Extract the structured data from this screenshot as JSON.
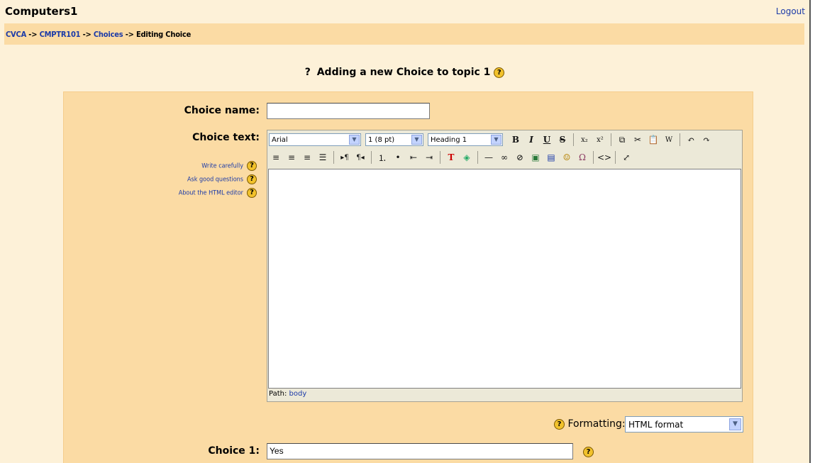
{
  "site": {
    "title": "Computers1",
    "logout": "Logout"
  },
  "breadcrumb": {
    "home": "CVCA",
    "course": "CMPTR101",
    "module": "Choices",
    "current": "Editing Choice",
    "separator": "->"
  },
  "heading": {
    "prefix": "?",
    "text": "Adding a new Choice to topic 1"
  },
  "form": {
    "choice_name_label": "Choice name:",
    "choice_name_value": "",
    "choice_text_label": "Choice text:",
    "help_links": [
      "Write carefully",
      "Ask good questions",
      "About the HTML editor"
    ],
    "formatting_label": "Formatting:",
    "formatting_value": "HTML format",
    "choice1_label": "Choice 1:",
    "choice1_value": "Yes"
  },
  "editor": {
    "font": "Arial",
    "size": "1 (8 pt)",
    "block": "Heading 1",
    "path_label": "Path:",
    "path_value": "body",
    "toolbar1": [
      "bold-icon",
      "italic-icon",
      "underline-icon",
      "strikethrough-icon",
      "subscript-icon",
      "superscript-icon",
      "copy-icon",
      "cut-icon",
      "paste-icon",
      "paste-word-icon",
      "undo-icon",
      "redo-icon"
    ],
    "toolbar2": [
      "align-left-icon",
      "align-center-icon",
      "align-right-icon",
      "justify-icon",
      "ltr-icon",
      "rtl-icon",
      "ordered-list-icon",
      "unordered-list-icon",
      "outdent-icon",
      "indent-icon",
      "text-color-icon",
      "background-color-icon",
      "horizontal-rule-icon",
      "link-icon",
      "unlink-icon",
      "image-icon",
      "table-icon",
      "smiley-icon",
      "special-char-icon",
      "html-source-icon",
      "fullscreen-icon"
    ]
  },
  "colors": {
    "page_bg": "#fdf1d8",
    "panel_bg": "#fbdba4",
    "link": "#1b3aa8"
  }
}
